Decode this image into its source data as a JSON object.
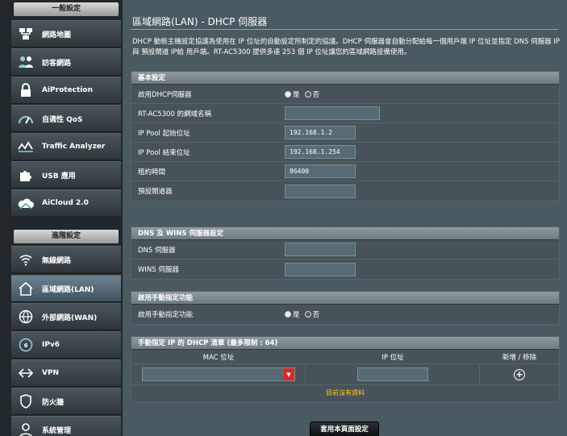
{
  "sidebar": {
    "general_header": "一般設定",
    "advanced_header": "進階設定",
    "general_items": [
      {
        "label": "網路地圖",
        "icon": "network-map-icon"
      },
      {
        "label": "訪客網路",
        "icon": "guest-network-icon"
      },
      {
        "label": "AiProtection",
        "icon": "lock-icon"
      },
      {
        "label": "自適性 QoS",
        "icon": "speedometer-icon"
      },
      {
        "label": "Traffic Analyzer",
        "icon": "traffic-analyzer-icon"
      },
      {
        "label": "USB 應用",
        "icon": "usb-puzzle-icon"
      },
      {
        "label": "AiCloud 2.0",
        "icon": "cloud-icon"
      }
    ],
    "advanced_items": [
      {
        "label": "無線網路",
        "icon": "wireless-icon"
      },
      {
        "label": "區域網路(LAN)",
        "icon": "home-icon",
        "active": true
      },
      {
        "label": "外部網路(WAN)",
        "icon": "globe-icon"
      },
      {
        "label": "IPv6",
        "icon": "ipv6-globe-icon"
      },
      {
        "label": "VPN",
        "icon": "vpn-icon"
      },
      {
        "label": "防火牆",
        "icon": "shield-icon"
      },
      {
        "label": "系統管理",
        "icon": "user-admin-icon"
      }
    ]
  },
  "main": {
    "title": "區域網路(LAN) - DHCP 伺服器",
    "description": "DHCP 動態主機設定協議為使用在 IP 位址的自動設定所制定的協議。DHCP 伺服器會自動分配給每一個用戶端 IP 位址並指定 DNS 伺服器 IP 與 預設閘道 IP給 用戶端。RT-AC5300 提供多達 253 個 IP 位址讓您的區域網路設備使用。",
    "basic": {
      "header": "基本設定",
      "enable_dhcp_label": "啟用DHCP伺服器",
      "yes": "是",
      "no": "否",
      "domain_label": "RT-AC5300 的網域名稱",
      "domain_value": "",
      "pool_start_label": "IP Pool 起始位址",
      "pool_start_value": "192.168.1.2",
      "pool_end_label": "IP Pool 結束位址",
      "pool_end_value": "192.168.1.254",
      "lease_label": "租約時間",
      "lease_value": "86400",
      "gateway_label": "預設閘道器",
      "gateway_value": ""
    },
    "dns": {
      "header": "DNS 及 WINS 伺服器設定",
      "dns_label": "DNS 伺服器",
      "dns_value": "",
      "wins_label": "WINS 伺服器",
      "wins_value": ""
    },
    "manual": {
      "header": "啟用手動指定功能",
      "enable_label": "啟用手動指定功能",
      "yes": "是",
      "no": "否"
    },
    "list": {
      "header": "手動指定 IP 的 DHCP 清單 (最多限制 : 64)",
      "col_mac": "MAC 位址",
      "col_ip": "IP 位址",
      "col_action": "新增 / 移除",
      "empty": "目前沒有資料"
    },
    "apply_label": "套用本頁面設定"
  }
}
